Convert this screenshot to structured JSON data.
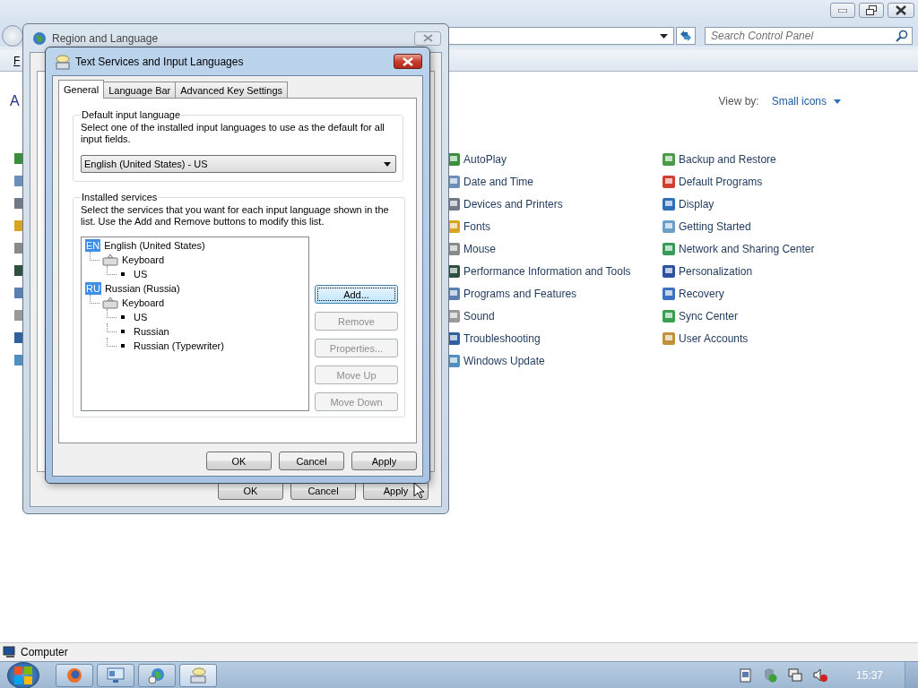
{
  "control_panel": {
    "menu_fragment": "F",
    "heading_fragment": "A",
    "search": {
      "placeholder": "Search Control Panel"
    },
    "view_by": {
      "label": "View by:",
      "value": "Small icons"
    },
    "columns": [
      [
        {
          "label": "AutoPlay"
        },
        {
          "label": "Date and Time"
        },
        {
          "label": "Devices and Printers"
        },
        {
          "label": "Fonts"
        },
        {
          "label": "Mouse"
        },
        {
          "label": "Performance Information and Tools"
        },
        {
          "label": "Programs and Features"
        },
        {
          "label": "Sound"
        },
        {
          "label": "Troubleshooting"
        },
        {
          "label": "Windows Update"
        }
      ],
      [
        {
          "label": "Backup and Restore"
        },
        {
          "label": "Default Programs"
        },
        {
          "label": "Display"
        },
        {
          "label": "Getting Started"
        },
        {
          "label": "Network and Sharing Center"
        },
        {
          "label": "Personalization"
        },
        {
          "label": "Recovery"
        },
        {
          "label": "Sync Center"
        },
        {
          "label": "User Accounts"
        }
      ]
    ],
    "status_bar": {
      "text": "Computer"
    }
  },
  "region_dialog": {
    "title": "Region and Language",
    "buttons": [
      {
        "label": "OK"
      },
      {
        "label": "Cancel"
      },
      {
        "label": "Apply"
      }
    ]
  },
  "text_services_dialog": {
    "title": "Text Services and Input Languages",
    "tabs": [
      {
        "label": "General",
        "selected": true
      },
      {
        "label": "Language Bar",
        "selected": false
      },
      {
        "label": "Advanced Key Settings",
        "selected": false
      }
    ],
    "default_input_language": {
      "legend": "Default input language",
      "description": "Select one of the installed input languages to use as the default for all input fields.",
      "value": "English (United States) - US"
    },
    "installed_services": {
      "legend": "Installed services",
      "description": "Select the services that you want for each input language shown in the list. Use the Add and Remove buttons to modify this list.",
      "tree": [
        {
          "kind": "language",
          "badge": "EN",
          "label": "English (United States)",
          "children": [
            {
              "kind": "category",
              "label": "Keyboard",
              "children": [
                {
                  "kind": "layout",
                  "label": "US"
                }
              ]
            }
          ]
        },
        {
          "kind": "language",
          "badge": "RU",
          "label": "Russian (Russia)",
          "children": [
            {
              "kind": "category",
              "label": "Keyboard",
              "children": [
                {
                  "kind": "layout",
                  "label": "US"
                },
                {
                  "kind": "layout",
                  "label": "Russian"
                },
                {
                  "kind": "layout",
                  "label": "Russian (Typewriter)"
                }
              ]
            }
          ]
        }
      ],
      "buttons": [
        {
          "label": "Add...",
          "disabled": false,
          "focused": true
        },
        {
          "label": "Remove",
          "disabled": true,
          "focused": false
        },
        {
          "label": "Properties...",
          "disabled": true,
          "focused": false
        },
        {
          "label": "Move Up",
          "disabled": true,
          "focused": false
        },
        {
          "label": "Move Down",
          "disabled": true,
          "focused": false
        }
      ]
    },
    "buttons": [
      {
        "label": "OK"
      },
      {
        "label": "Cancel"
      },
      {
        "label": "Apply"
      }
    ]
  },
  "taskbar": {
    "clock": "15:37"
  }
}
